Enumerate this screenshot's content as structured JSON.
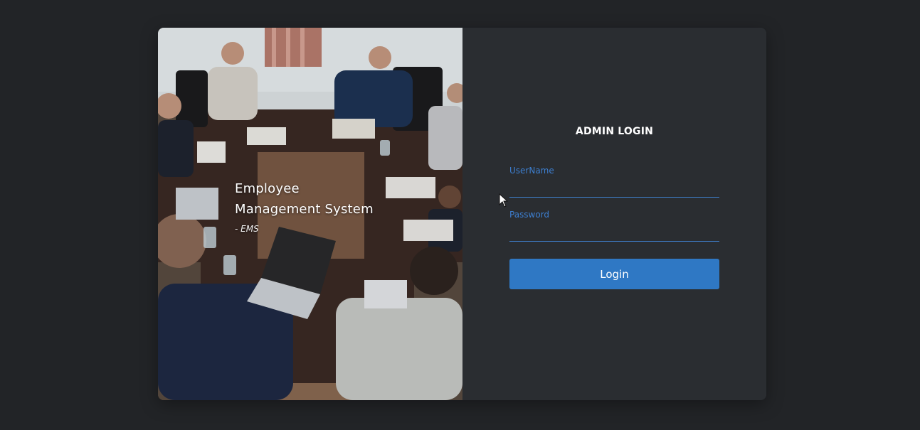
{
  "hero": {
    "title_line1": "Employee",
    "title_line2": "Management System",
    "subtitle": "- EMS"
  },
  "login": {
    "title": "ADMIN LOGIN",
    "username_label": "UserName",
    "username_value": "",
    "password_label": "Password",
    "password_value": "",
    "button_label": "Login"
  },
  "colors": {
    "page_background": "#222427",
    "panel_background": "#2a2d31",
    "accent_blue": "#2f78c4",
    "label_blue": "#3d7fd0"
  },
  "icons": {
    "cursor": "mouse-pointer-icon"
  }
}
